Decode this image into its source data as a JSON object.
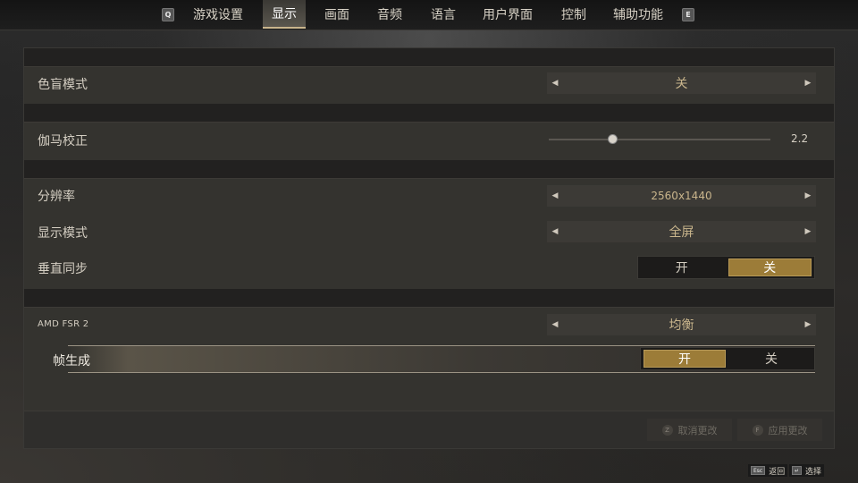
{
  "nav": {
    "prev_key": "Q",
    "next_key": "E",
    "tabs": [
      {
        "label": "游戏设置"
      },
      {
        "label": "显示"
      },
      {
        "label": "画面"
      },
      {
        "label": "音频"
      },
      {
        "label": "语言"
      },
      {
        "label": "用户界面"
      },
      {
        "label": "控制"
      },
      {
        "label": "辅助功能"
      }
    ],
    "active_tab": "显示"
  },
  "settings": {
    "colorblind": {
      "label": "色盲模式",
      "value": "关"
    },
    "gamma": {
      "label": "伽马校正",
      "value": "2.2",
      "slider_fraction": 0.29
    },
    "resolution": {
      "label": "分辨率",
      "value": "2560x1440"
    },
    "display_mode": {
      "label": "显示模式",
      "value": "全屏"
    },
    "vsync": {
      "label": "垂直同步",
      "option_on": "开",
      "option_off": "关",
      "selected": "关"
    },
    "fsr": {
      "label": "AMD FSR 2",
      "value": "均衡"
    },
    "frame_gen": {
      "label": "帧生成",
      "option_on": "开",
      "option_off": "关",
      "selected": "开"
    }
  },
  "footer": {
    "discard": {
      "key": "Z",
      "label": "取消更改"
    },
    "apply": {
      "key": "F",
      "label": "应用更改"
    }
  },
  "hints": {
    "back": {
      "key": "Esc",
      "label": "返回"
    },
    "select": {
      "key": "↵",
      "label": "选择"
    }
  },
  "colors": {
    "accent": "#c9b58c",
    "toggle_on": "#9c7c38"
  }
}
